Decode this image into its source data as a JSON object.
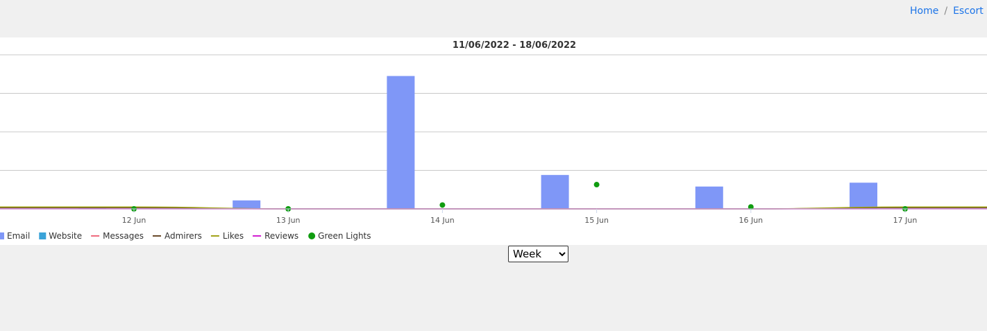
{
  "breadcrumb": {
    "home": "Home",
    "separator": "/",
    "current": "Escort L"
  },
  "range_select": {
    "selected": "Week"
  },
  "colors": {
    "email": "#7f97f7",
    "website": "#3aa3d8",
    "messages": "#ef6b7e",
    "admirers": "#6a4a2a",
    "likes": "#a2a319",
    "reviews": "#d11fd1",
    "green_lights": "#109c10",
    "link": "#1a73e8"
  },
  "chart_data": {
    "type": "bar",
    "title": "11/06/2022 - 18/06/2022",
    "categories": [
      "12 Jun",
      "13 Jun",
      "14 Jun",
      "15 Jun",
      "16 Jun",
      "17 Jun"
    ],
    "ylim": [
      0,
      40
    ],
    "grid": true,
    "legend": "bottom-left",
    "series": [
      {
        "name": "Email",
        "kind": "bar",
        "values": [
          0.5,
          2.2,
          34.5,
          8.8,
          5.8,
          6.8
        ]
      },
      {
        "name": "Website",
        "kind": "bar",
        "values": [
          0,
          0,
          0,
          0,
          0,
          0
        ]
      },
      {
        "name": "Messages",
        "kind": "line",
        "values": [
          0,
          0,
          0,
          0,
          0,
          0
        ]
      },
      {
        "name": "Admirers",
        "kind": "line",
        "values": [
          0.3,
          0,
          0,
          0,
          0,
          0.3
        ]
      },
      {
        "name": "Likes",
        "kind": "line",
        "values": [
          0.5,
          0,
          0,
          0,
          0,
          0.5
        ]
      },
      {
        "name": "Reviews",
        "kind": "line",
        "values": [
          0,
          0,
          0,
          0,
          0,
          0
        ]
      },
      {
        "name": "Green Lights",
        "kind": "scatter",
        "values": [
          0,
          0,
          1,
          6.3,
          0.5,
          0
        ]
      }
    ]
  }
}
